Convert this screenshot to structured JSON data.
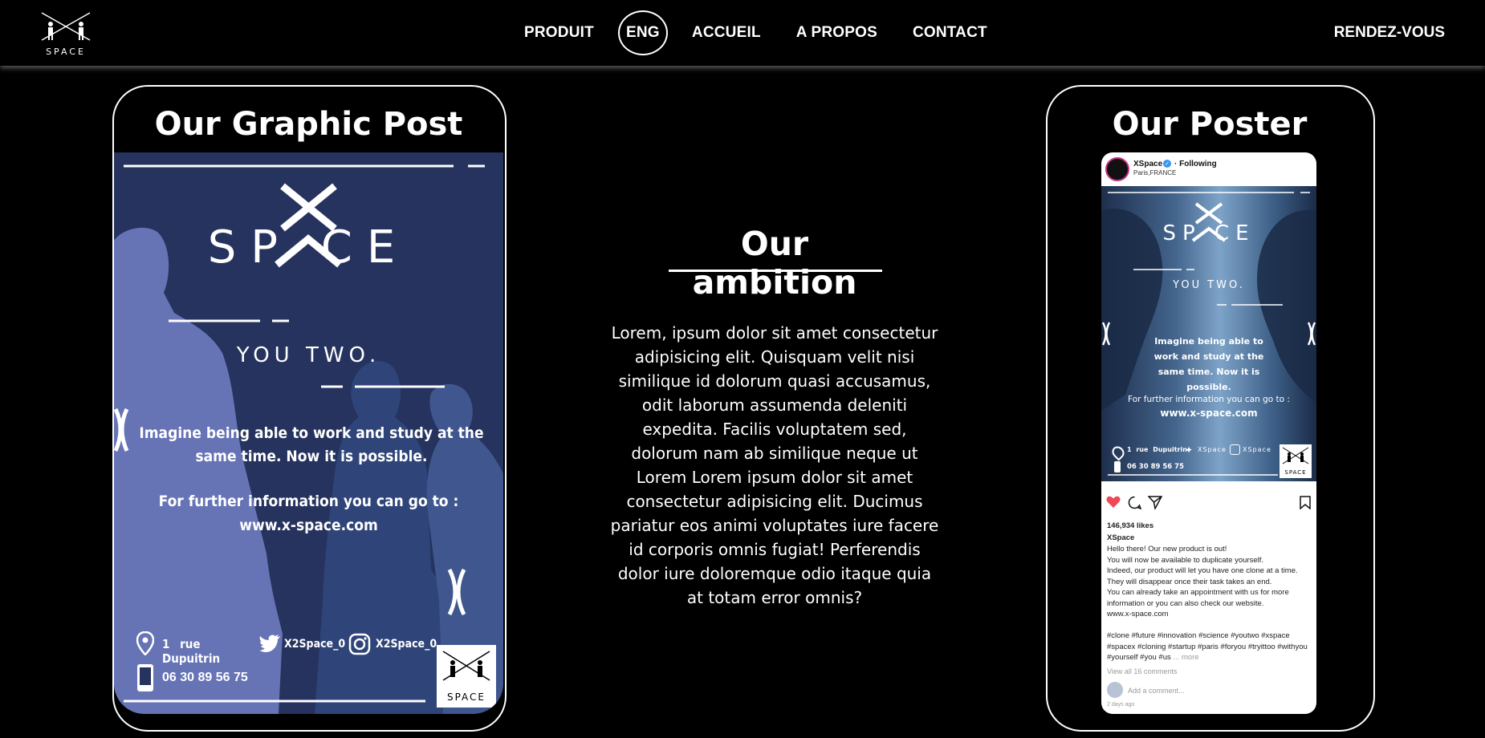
{
  "nav": {
    "logo_text": "SPACE",
    "items": [
      "PRODUIT",
      "ENG",
      "ACCUEIL",
      "A PROPOS",
      "CONTACT"
    ],
    "cta": "RENDEZ-VOUS"
  },
  "graphic_post": {
    "title": "Our Graphic Post",
    "brand": "SP  CE",
    "tagline": "YOU TWO.",
    "pitch": "Imagine being able to work and study at the same time. Now it is possible.",
    "info": "For further information you can go to :",
    "url": "www.x-space.com",
    "address": "1 rue Dupuitrin",
    "twitter": "X2Space_0",
    "instagram": "X2Space_0",
    "phone": "06 30 89 56 75",
    "stamp_text": "SPACE"
  },
  "ambition": {
    "title": "Our ambition",
    "body": "Lorem, ipsum dolor sit amet consectetur adipisicing elit. Quisquam velit nisi similique id dolorum quasi accusamus, odit laborum assumenda deleniti expedita. Facilis voluptatem sed, dolorum nam ab similique neque ut Lorem Lorem ipsum dolor sit amet consectetur adipisicing elit. Ducimus pariatur eos animi voluptates iure facere id corporis omnis fugiat! Perferendis dolor iure doloremque odio itaque quia at totam error omnis?"
  },
  "poster": {
    "title": "Our Poster",
    "account": "XSpace",
    "following": "· Following",
    "location": "Paris,FRANCE",
    "photo_brand": "SP  CE",
    "photo_tagline": "YOU TWO.",
    "photo_pitch": "Imagine being able to work and study at the same time. Now it is possible.",
    "photo_info": "For further information you can go to :",
    "photo_url": "www.x-space.com",
    "photo_address": "1 rue Dupuitrin",
    "photo_twitter": "XSpace",
    "photo_instagram": "XSpace",
    "photo_phone": "06 30 89 56 75",
    "photo_stamp": "SPACE",
    "likes": "146,934 likes",
    "caption_user": "XSpace",
    "caption_lines": [
      "Hello there! Our new product is out!",
      "You will now be available to duplicate yourself.",
      "Indeed, our product will let you have one clone at a time.",
      "They will disappear once their task takes an end.",
      "You can already take an appointment with us for more",
      "information or you can also check our website.",
      "www.x-space.com"
    ],
    "hashtags": "#clone #future #innovation #science #youtwo #xspace #spacex #cloning #startup #paris #foryou #tryittoo #withyou #yourself #you #us",
    "more": "... more",
    "comments": "View all 16 comments",
    "add_comment": "Add a comment...",
    "time": "2 days ago"
  },
  "colors": {
    "background": "#000000",
    "post_bg": "#25335e",
    "silhouette_light": "#6673b5",
    "silhouette_dark": "#2f4478",
    "like_red": "#ed4956"
  }
}
